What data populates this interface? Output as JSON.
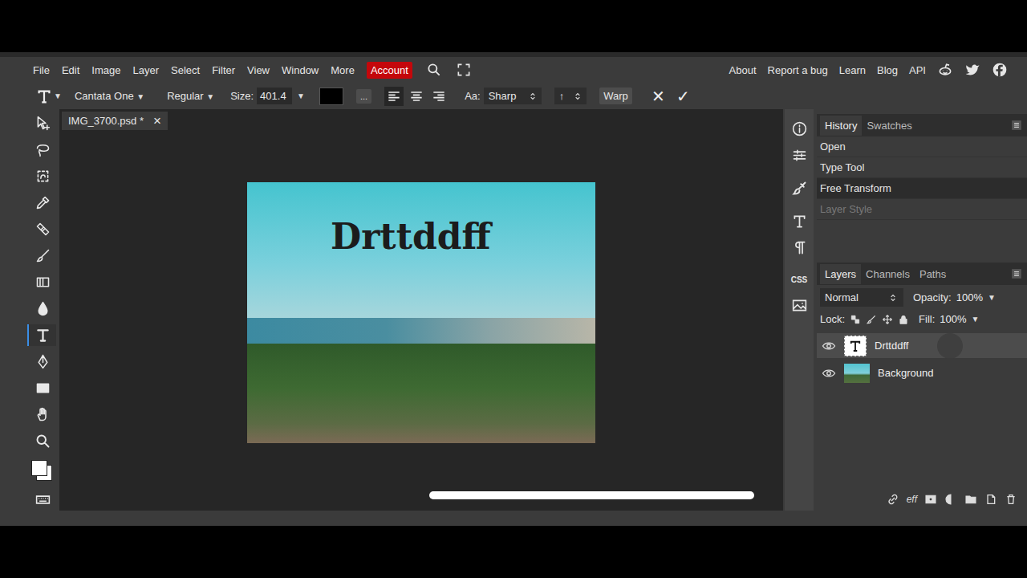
{
  "app": "Photopea",
  "menu": {
    "items": [
      {
        "label": "File",
        "highlighted": false
      },
      {
        "label": "Edit",
        "highlighted": false
      },
      {
        "label": "Image",
        "highlighted": false
      },
      {
        "label": "Layer",
        "highlighted": false
      },
      {
        "label": "Select",
        "highlighted": false
      },
      {
        "label": "Filter",
        "highlighted": false
      },
      {
        "label": "View",
        "highlighted": false
      },
      {
        "label": "Window",
        "highlighted": false
      },
      {
        "label": "More",
        "highlighted": false
      },
      {
        "label": "Account",
        "highlighted": true
      }
    ],
    "links": [
      "About",
      "Report a bug",
      "Learn",
      "Blog",
      "API"
    ]
  },
  "options_bar": {
    "tool_arrow": "▼",
    "font": {
      "value": "Cantata One",
      "arrow": "▼"
    },
    "style": {
      "value": "Regular",
      "arrow": "▼"
    },
    "size": {
      "label": "Size:",
      "value": "401.4",
      "arrow": "▼"
    },
    "color": "#000000",
    "more": "...",
    "align": [
      {
        "kind": "align-left",
        "selected": true
      },
      {
        "kind": "align-center",
        "selected": false
      },
      {
        "kind": "align-right",
        "selected": false
      }
    ],
    "antialias": {
      "label": "Aa:",
      "value": "Sharp"
    },
    "orientation": "↑",
    "warp": "Warp",
    "cancel": "✕",
    "commit": "✓"
  },
  "tools": [
    {
      "kind": "move",
      "selected": false
    },
    {
      "kind": "lasso",
      "selected": false
    },
    {
      "kind": "quickselect",
      "selected": false
    },
    {
      "kind": "eyedropper",
      "selected": false
    },
    {
      "kind": "heal",
      "selected": false
    },
    {
      "kind": "brush",
      "selected": false
    },
    {
      "kind": "gradient",
      "selected": false
    },
    {
      "kind": "blur",
      "selected": false
    },
    {
      "kind": "type",
      "selected": true
    },
    {
      "kind": "pen",
      "selected": false
    },
    {
      "kind": "rect",
      "selected": false
    },
    {
      "kind": "hand",
      "selected": false
    },
    {
      "kind": "zoom",
      "selected": false
    }
  ],
  "colors": {
    "foreground": "#ffffff",
    "background": "#ffffff"
  },
  "document": {
    "tab": "IMG_3700.psd *",
    "close": "×"
  },
  "canvas": {
    "text_layer": "Drttddff",
    "text_color": "#1c1c1c"
  },
  "icon_column": [
    {
      "kind": "info"
    },
    {
      "kind": "adjust"
    },
    {
      "kind": "brush-panel"
    },
    {
      "kind": "type-panel"
    },
    {
      "kind": "paragraph"
    },
    {
      "kind": "css",
      "label": "CSS"
    },
    {
      "kind": "image"
    }
  ],
  "history": {
    "tabs": [
      {
        "label": "History",
        "selected": true
      },
      {
        "label": "Swatches",
        "selected": false
      }
    ],
    "items": [
      {
        "label": "Open",
        "selected": false,
        "disabled": false
      },
      {
        "label": "Type Tool",
        "selected": false,
        "disabled": false
      },
      {
        "label": "Free Transform",
        "selected": true,
        "disabled": false
      },
      {
        "label": "Layer Style",
        "selected": false,
        "disabled": true
      }
    ]
  },
  "layers": {
    "tabs": [
      {
        "label": "Layers",
        "selected": true
      },
      {
        "label": "Channels",
        "selected": false
      },
      {
        "label": "Paths",
        "selected": false
      }
    ],
    "blend_mode": "Normal",
    "opacity": {
      "label": "Opacity:",
      "value": "100%",
      "arrow": "▼"
    },
    "lock_label": "Lock:",
    "fill": {
      "label": "Fill:",
      "value": "100%",
      "arrow": "▼"
    },
    "items": [
      {
        "name": "Drttddff",
        "kind": "text",
        "visible": true,
        "selected": true
      },
      {
        "name": "Background",
        "kind": "image",
        "visible": true,
        "selected": false
      }
    ],
    "footer_label": "eff"
  }
}
